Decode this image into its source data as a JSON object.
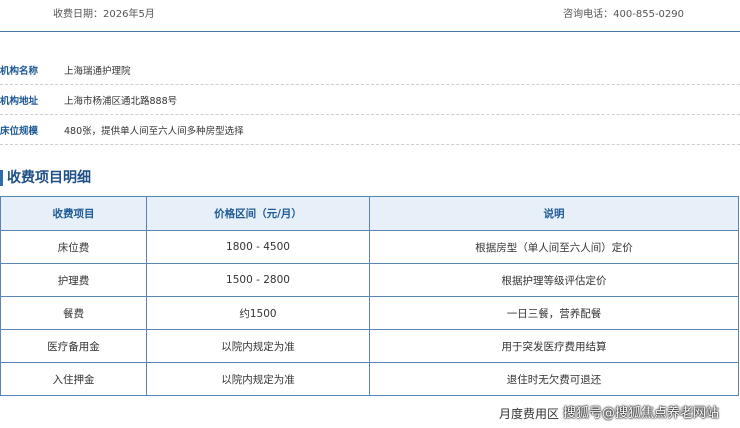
{
  "header": {
    "fee_date": "收费日期：2026年5月",
    "phone": "咨询电话：400-855-0290"
  },
  "info": [
    {
      "label": "机构名称",
      "value": "上海瑞通护理院"
    },
    {
      "label": "机构地址",
      "value": "上海市杨浦区通北路888号"
    },
    {
      "label": "床位规模",
      "value": "480张，提供单人间至六人间多种房型选择"
    }
  ],
  "section_title": "收费项目明细",
  "table": {
    "headers": [
      "收费项目",
      "价格区间（元/月）",
      "说明"
    ],
    "rows": [
      [
        "床位费",
        "1800 - 4500",
        "根据房型（单人间至六人间）定价"
      ],
      [
        "护理费",
        "1500 - 2800",
        "根据护理等级评估定价"
      ],
      [
        "餐费",
        "约1500",
        "一日三餐，营养配餐"
      ],
      [
        "医疗备用金",
        "以院内规定为准",
        "用于突发医疗费用结算"
      ],
      [
        "入住押金",
        "以院内规定为准",
        "退住时无欠费可退还"
      ]
    ]
  },
  "footer": {
    "text": "月度费用区",
    "watermark": "搜狐号@搜狐焦点养老网站"
  }
}
